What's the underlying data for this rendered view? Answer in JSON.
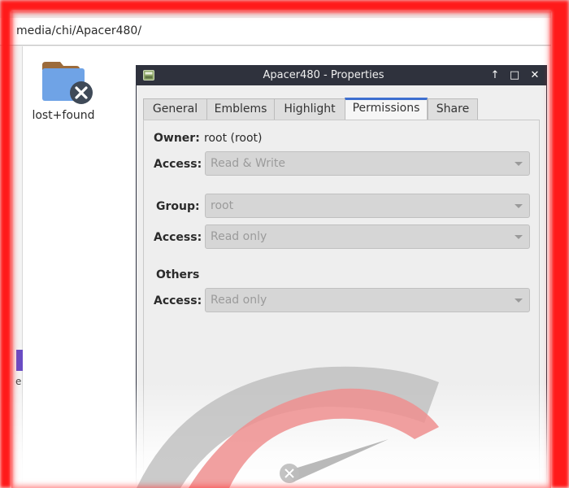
{
  "pathbar": {
    "path": "media/chi/Apacer480/"
  },
  "folder": {
    "label": "lost+found",
    "icon": "folder-broken-icon"
  },
  "sidebar": {
    "partial_char": "e"
  },
  "dialog": {
    "title": "Apacer480 - Properties",
    "titlebar_buttons": {
      "up": "↑",
      "maximize": "□",
      "close": "✕"
    },
    "tabs": [
      {
        "label": "General"
      },
      {
        "label": "Emblems"
      },
      {
        "label": "Highlight"
      },
      {
        "label": "Permissions"
      },
      {
        "label": "Share"
      }
    ],
    "active_tab": "Permissions",
    "owner": {
      "label": "Owner:",
      "value": "root (root)",
      "access_label": "Access:",
      "access_value": "Read & Write"
    },
    "group": {
      "label": "Group:",
      "value": "root",
      "access_label": "Access:",
      "access_value": "Read only"
    },
    "others": {
      "label": "Others",
      "access_label": "Access:",
      "access_value": "Read only"
    }
  },
  "colors": {
    "titlebar": "#2f323d",
    "active_tab_accent": "#3d6fd0",
    "frame": "#ff1a1a",
    "folder": "#6fa3e6",
    "watermark_red": "#ee8f8f"
  }
}
